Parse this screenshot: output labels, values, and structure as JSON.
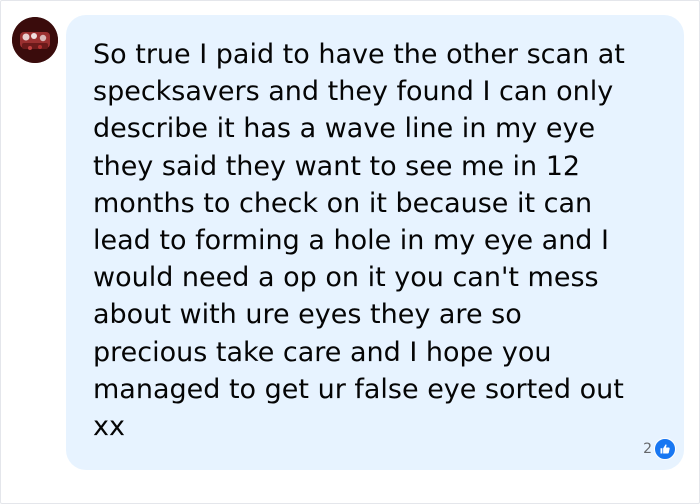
{
  "comment": {
    "text": "So true I paid to have the other scan at\nspecksavers and they found I can only\ndescribe it has a wave line in my eye\nthey said they want to see me in 12\nmonths to check on it because it can\nlead to forming a hole in my eye and I\nwould need a op on it you can't mess\nabout with ure eyes they are so\nprecious take care and I hope you\nmanaged to get ur false eye sorted out\nxx"
  },
  "reactions": {
    "count": "2",
    "icon": "thumbs-up-icon"
  },
  "colors": {
    "bubble": "#e7f3ff",
    "text": "#050505",
    "like": "#1877f2"
  }
}
